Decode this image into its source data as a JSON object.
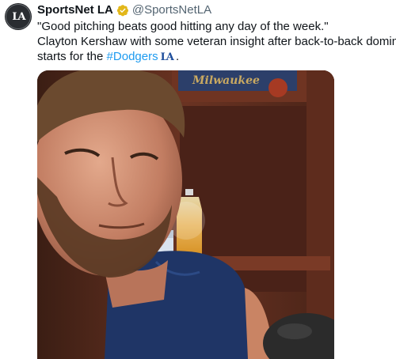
{
  "tweet": {
    "avatar_icon": "la-dodgers-logo-icon",
    "display_name": "SportsNet LA",
    "verified_icon": "gold-verified-badge-icon",
    "handle": "@SportsNetLA",
    "text_line1": "\"Good pitching beats good hitting any day of the week.\"",
    "text_line2": "Clayton Kershaw with some veteran insight after back-to-back dominant",
    "text_line3_prefix": "starts for the ",
    "hashtag": "#Dodgers",
    "text_line3_suffix": " .",
    "team_emoji_icon": "dodgers-la-emoji-icon"
  },
  "media": {
    "locker_sign_text": "Milwaukee",
    "colors": {
      "verified": "#e2b719",
      "hashtag": "#1d9bf0",
      "locker_wood": "#5a2a1c",
      "jersey": "#1f3566"
    }
  }
}
